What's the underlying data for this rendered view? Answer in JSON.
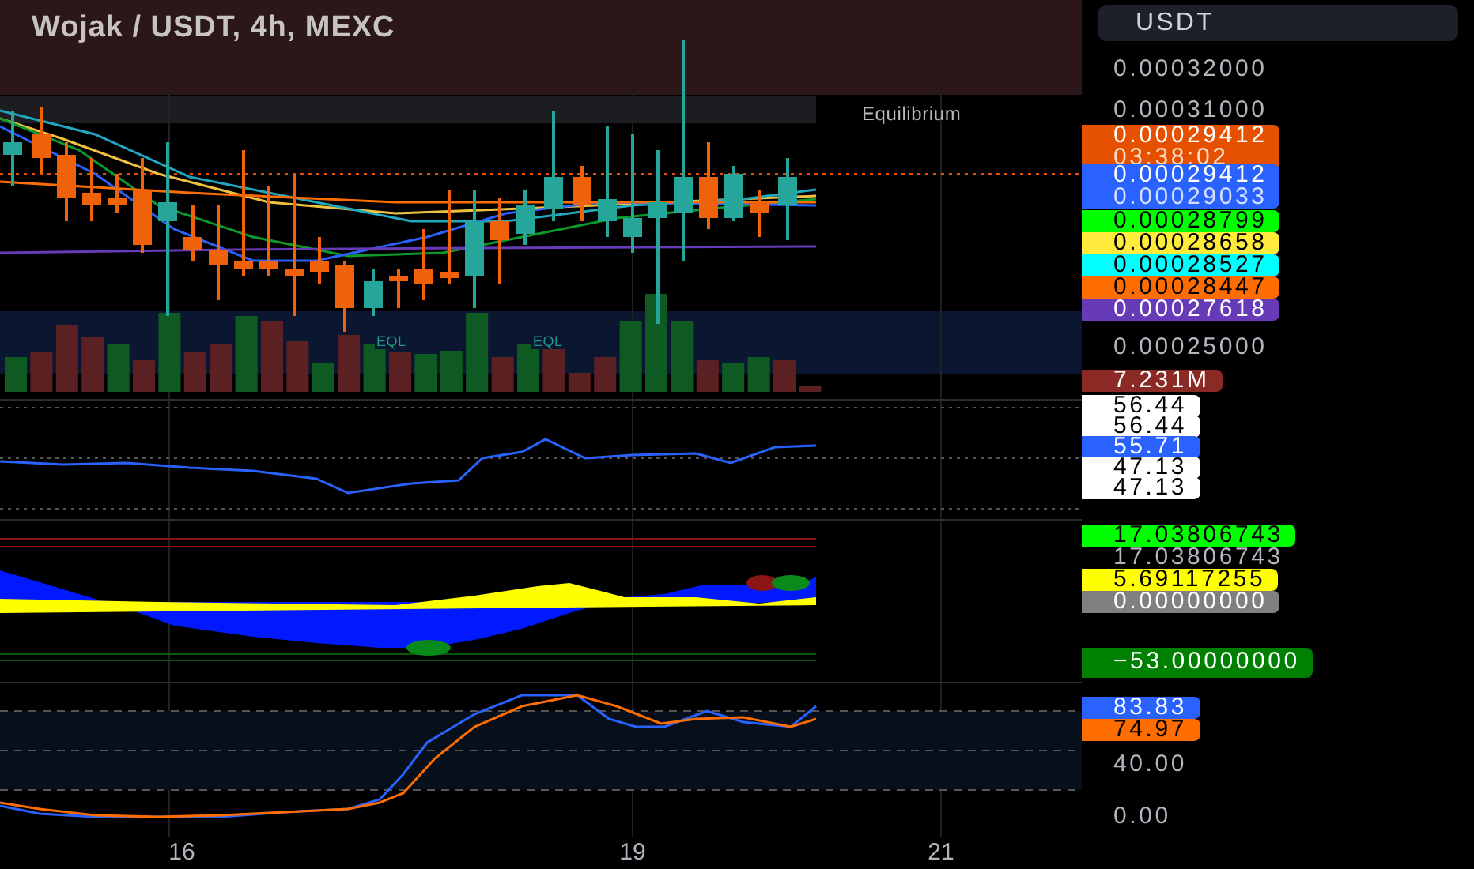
{
  "header": {
    "title": "Wojak / USDT, 4h, MEXC"
  },
  "currency_button": {
    "label": "USDT"
  },
  "price_pane": {
    "zone_label": "Equilibrium",
    "level_labels": [
      "EQL",
      "EQL"
    ]
  },
  "axis_labels": [
    {
      "kind": "tick",
      "texts": [
        "0.00032000"
      ]
    },
    {
      "kind": "tick",
      "texts": [
        "0.00031000"
      ]
    },
    {
      "kind": "badge",
      "color": "#e65100",
      "texts": [
        "0.00029412",
        "03:38:02"
      ]
    },
    {
      "kind": "badge",
      "color": "#2962ff",
      "texts": [
        "0.00029412",
        "0.00029033"
      ]
    },
    {
      "kind": "badge",
      "color": "#00ff00",
      "texts": [
        "0.00028799"
      ]
    },
    {
      "kind": "badge",
      "color": "#ffeb3b",
      "texts": [
        "0.00028658"
      ]
    },
    {
      "kind": "badge",
      "color": "#00ffff",
      "texts": [
        "0.00028527"
      ]
    },
    {
      "kind": "badge",
      "color": "#ff6d00",
      "texts": [
        "0.00028447"
      ]
    },
    {
      "kind": "badge",
      "color": "#673ab7",
      "texts": [
        "0.00027618"
      ]
    },
    {
      "kind": "tick",
      "texts": [
        "0.00025000"
      ]
    },
    {
      "kind": "badge",
      "color": "#8b2a25",
      "texts": [
        "7.231M"
      ]
    },
    {
      "kind": "badge",
      "color": "#ffffff",
      "texts": [
        "56.44"
      ]
    },
    {
      "kind": "badge",
      "color": "#ffffff",
      "texts": [
        "56.44"
      ]
    },
    {
      "kind": "badge",
      "color": "#2962ff",
      "texts": [
        "55.71"
      ]
    },
    {
      "kind": "badge",
      "color": "#ffffff",
      "texts": [
        "47.13"
      ]
    },
    {
      "kind": "badge",
      "color": "#ffffff",
      "texts": [
        "47.13"
      ]
    },
    {
      "kind": "badge",
      "color": "#00ff00",
      "texts": [
        "17.03806743"
      ]
    },
    {
      "kind": "tick",
      "texts": [
        "17.03806743"
      ]
    },
    {
      "kind": "badge",
      "color": "#ffff00",
      "texts": [
        "5.69117255"
      ]
    },
    {
      "kind": "badge",
      "color": "#808080",
      "texts": [
        "0.00000000"
      ]
    },
    {
      "kind": "badge",
      "color": "#008000",
      "texts": [
        "−53.00000000"
      ]
    },
    {
      "kind": "badge",
      "color": "#2962ff",
      "texts": [
        "83.83"
      ]
    },
    {
      "kind": "badge",
      "color": "#ff6d00",
      "texts": [
        "74.97"
      ]
    },
    {
      "kind": "tick",
      "texts": [
        "40.00"
      ]
    },
    {
      "kind": "tick",
      "texts": [
        "0.00"
      ]
    }
  ],
  "time_axis": [
    "16",
    "19",
    "21"
  ]
}
